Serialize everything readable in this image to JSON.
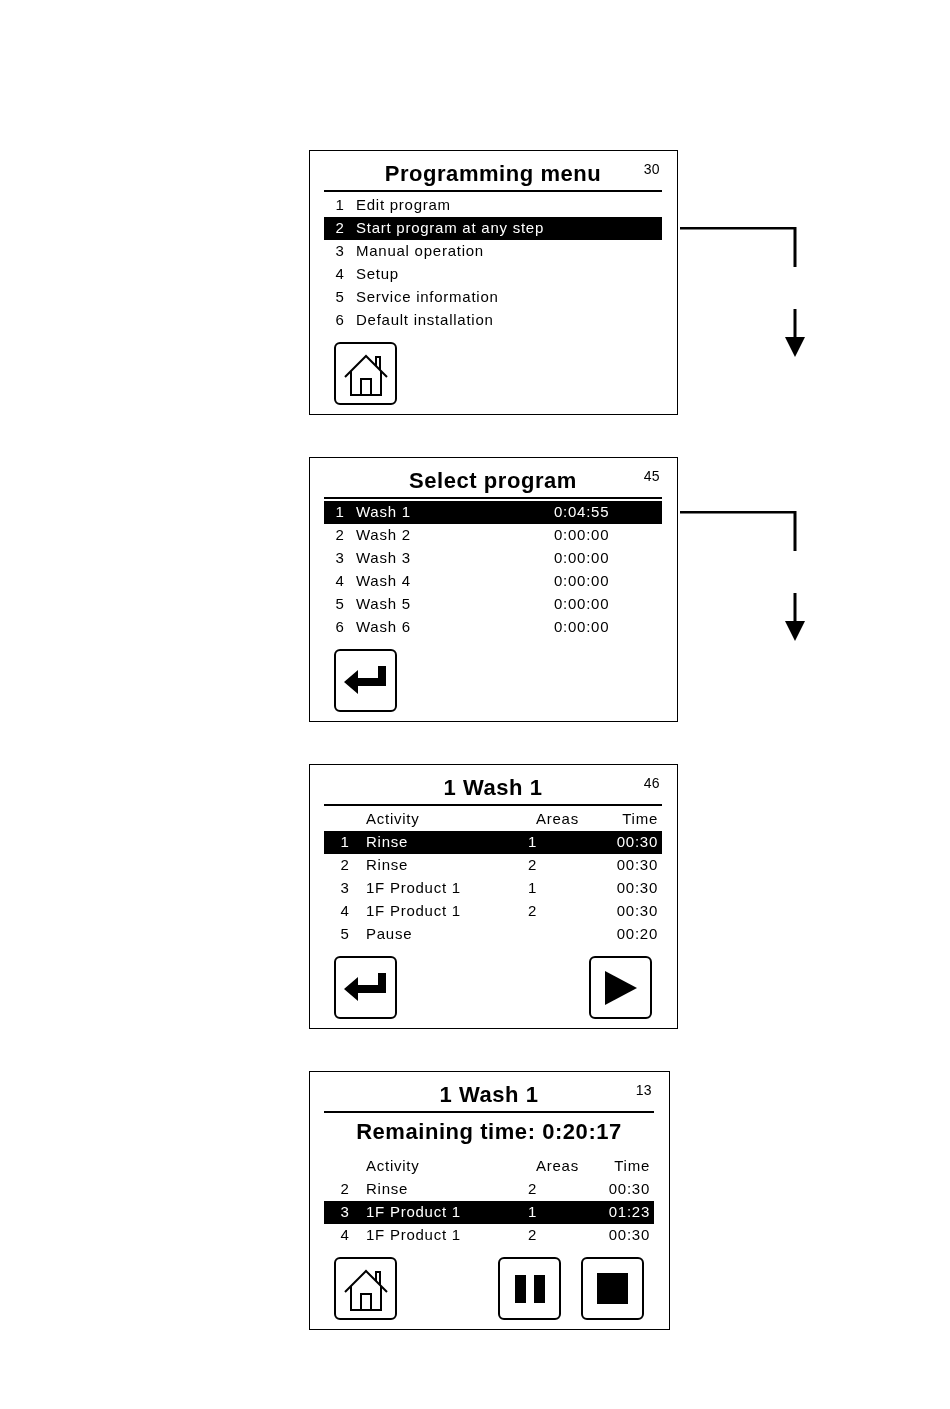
{
  "screens": [
    {
      "kind": "menu",
      "title": "Programming menu",
      "number": "30",
      "arrow": true,
      "rows": [
        {
          "cells": [
            "1",
            "Edit program"
          ],
          "selected": false
        },
        {
          "cells": [
            "2",
            "Start program at any step"
          ],
          "selected": true
        },
        {
          "cells": [
            "3",
            "Manual operation"
          ],
          "selected": false
        },
        {
          "cells": [
            "4",
            "Setup"
          ],
          "selected": false
        },
        {
          "cells": [
            "5",
            "Service information"
          ],
          "selected": false
        },
        {
          "cells": [
            "6",
            "Default installation"
          ],
          "selected": false
        }
      ],
      "buttons": [
        {
          "kind": "home"
        }
      ]
    },
    {
      "kind": "programs",
      "title": "Select program",
      "number": "45",
      "arrow": true,
      "rows": [
        {
          "cells": [
            "1",
            "Wash 1",
            "0:04:55"
          ],
          "selected": true
        },
        {
          "cells": [
            "2",
            "Wash 2",
            "0:00:00"
          ],
          "selected": false
        },
        {
          "cells": [
            "3",
            "Wash 3",
            "0:00:00"
          ],
          "selected": false
        },
        {
          "cells": [
            "4",
            "Wash 4",
            "0:00:00"
          ],
          "selected": false
        },
        {
          "cells": [
            "5",
            "Wash 5",
            "0:00:00"
          ],
          "selected": false
        },
        {
          "cells": [
            "6",
            "Wash 6",
            "0:00:00"
          ],
          "selected": false
        }
      ],
      "buttons": [
        {
          "kind": "back"
        }
      ]
    },
    {
      "kind": "steps",
      "title": "1 Wash 1",
      "number": "46",
      "arrow": false,
      "columns": [
        "",
        "Activity",
        "Areas",
        "Time"
      ],
      "rows": [
        {
          "cells": [
            "1",
            "Rinse",
            "1",
            "00:30"
          ],
          "selected": true
        },
        {
          "cells": [
            "2",
            "Rinse",
            "2",
            "00:30"
          ],
          "selected": false
        },
        {
          "cells": [
            "3",
            "1F Product 1",
            "1",
            "00:30"
          ],
          "selected": false
        },
        {
          "cells": [
            "4",
            "1F Product 1",
            "2",
            "00:30"
          ],
          "selected": false
        },
        {
          "cells": [
            "5",
            "Pause",
            "",
            "00:20"
          ],
          "selected": false
        }
      ],
      "buttons": [
        {
          "kind": "back"
        },
        {
          "kind": "play"
        }
      ]
    },
    {
      "kind": "steps",
      "title": "1 Wash 1",
      "number": "13",
      "arrow": false,
      "remaining": "Remaining time: 0:20:17",
      "columns": [
        "",
        "Activity",
        "Areas",
        "Time"
      ],
      "rows": [
        {
          "cells": [
            "2",
            "Rinse",
            "2",
            "00:30"
          ],
          "selected": false
        },
        {
          "cells": [
            "3",
            "1F Product 1",
            "1",
            "01:23"
          ],
          "selected": true
        },
        {
          "cells": [
            "4",
            "1F Product 1",
            "2",
            "00:30"
          ],
          "selected": false
        }
      ],
      "buttons": [
        {
          "kind": "home"
        },
        {
          "kind": "pause"
        },
        {
          "kind": "stop"
        }
      ]
    }
  ]
}
